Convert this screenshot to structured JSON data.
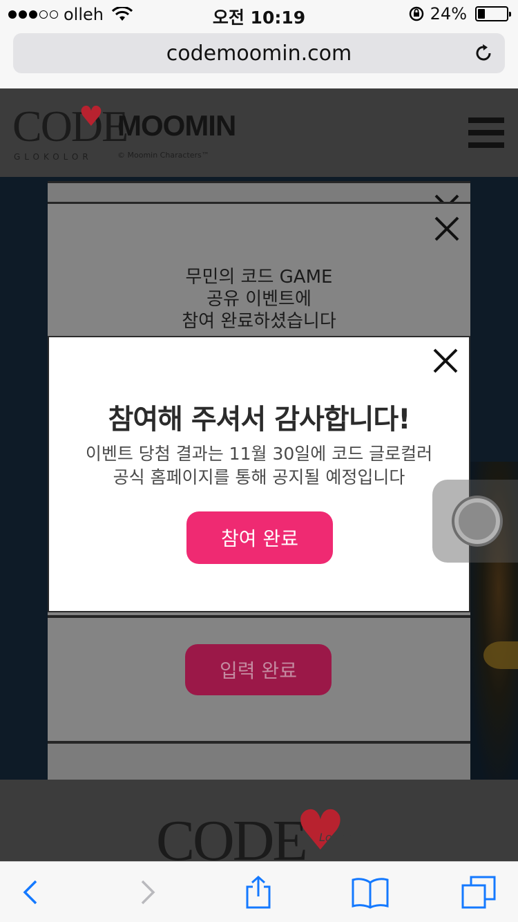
{
  "status_bar": {
    "carrier": "olleh",
    "time": "오전 10:19",
    "battery_percent": "24%",
    "battery_level": 0.24,
    "signal_bars_filled": 3,
    "signal_bars_total": 5
  },
  "browser": {
    "url": "codemoomin.com",
    "toolbar": {
      "back_icon": "chevron-left-icon",
      "forward_icon": "chevron-right-icon",
      "share_icon": "share-icon",
      "bookmarks_icon": "book-icon",
      "tabs_icon": "tabs-icon"
    }
  },
  "site": {
    "logo": {
      "code": "CODE",
      "loves": "Loves",
      "moomin": "MOOMIN",
      "glo": "GLOKOLOR",
      "copyright": "© Moomin Characters™"
    },
    "menu_icon": "hamburger-icon"
  },
  "background_popup": {
    "message_line_1": "무민의 코드 GAME",
    "message_line_2": "공유 이벤트에",
    "message_line_3": "참여 완료하셨습니다",
    "button_label": "입력 완료"
  },
  "modal": {
    "title": "참여해 주셔서 감사합니다!",
    "message_line_1": "이벤트 당첨 결과는 11월 30일에 코드 글로컬러",
    "message_line_2": "공식 홈페이지를 통해 공지될 예정입니다",
    "confirm_label": "참여 완료",
    "close_icon": "close-icon"
  },
  "footer": {
    "code": "CODE",
    "loves": "Loves"
  },
  "colors": {
    "accent": "#ef2a72",
    "page_header": "#3c3c3c",
    "overlay_gray": "#848484"
  }
}
